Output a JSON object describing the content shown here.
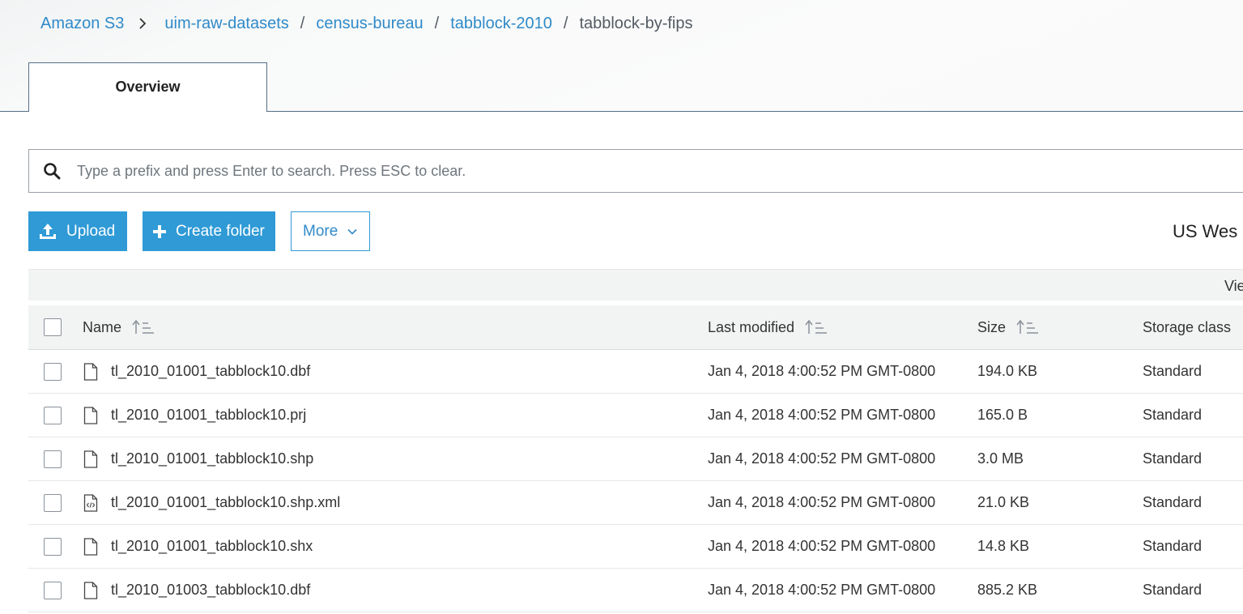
{
  "breadcrumb": {
    "root": "Amazon S3",
    "items": [
      "uim-raw-datasets",
      "census-bureau",
      "tabblock-2010"
    ],
    "current": "tabblock-by-fips",
    "separator": "/"
  },
  "tabs": {
    "overview": "Overview"
  },
  "search": {
    "placeholder": "Type a prefix and press Enter to search. Press ESC to clear."
  },
  "actions": {
    "upload": "Upload",
    "create_folder": "Create folder",
    "more": "More"
  },
  "region_label": "US Wes",
  "view_label": "Vie",
  "table": {
    "headers": {
      "name": "Name",
      "last_modified": "Last modified",
      "size": "Size",
      "storage_class": "Storage class"
    },
    "rows": [
      {
        "name": "tl_2010_01001_tabblock10.dbf",
        "last_modified": "Jan 4, 2018 4:00:52 PM GMT-0800",
        "size": "194.0 KB",
        "storage_class": "Standard",
        "icon": "file-icon"
      },
      {
        "name": "tl_2010_01001_tabblock10.prj",
        "last_modified": "Jan 4, 2018 4:00:52 PM GMT-0800",
        "size": "165.0 B",
        "storage_class": "Standard",
        "icon": "file-icon"
      },
      {
        "name": "tl_2010_01001_tabblock10.shp",
        "last_modified": "Jan 4, 2018 4:00:52 PM GMT-0800",
        "size": "3.0 MB",
        "storage_class": "Standard",
        "icon": "file-icon"
      },
      {
        "name": "tl_2010_01001_tabblock10.shp.xml",
        "last_modified": "Jan 4, 2018 4:00:52 PM GMT-0800",
        "size": "21.0 KB",
        "storage_class": "Standard",
        "icon": "code-file-icon"
      },
      {
        "name": "tl_2010_01001_tabblock10.shx",
        "last_modified": "Jan 4, 2018 4:00:52 PM GMT-0800",
        "size": "14.8 KB",
        "storage_class": "Standard",
        "icon": "file-icon"
      },
      {
        "name": "tl_2010_01003_tabblock10.dbf",
        "last_modified": "Jan 4, 2018 4:00:52 PM GMT-0800",
        "size": "885.2 KB",
        "storage_class": "Standard",
        "icon": "file-icon"
      }
    ]
  },
  "colors": {
    "link": "#2f8ac9",
    "primary_button": "#2f9ad6",
    "tab_border": "#556f87"
  }
}
